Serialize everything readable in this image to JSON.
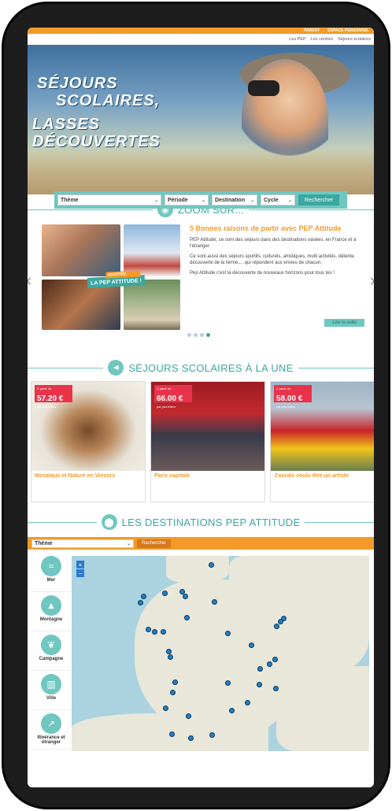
{
  "topbar": {
    "links": [
      "PARENT",
      "ESPACE PERSONNEL"
    ]
  },
  "subnav": {
    "links": [
      "Les PEP",
      "Les centres",
      "Séjours scolaires"
    ]
  },
  "hero": {
    "title_line1": "SÉJOURS",
    "title_line2": "SCOLAIRES,",
    "title_line3": "LASSES",
    "title_line4": "DÉCOUVERTES"
  },
  "search": {
    "theme": "Thème",
    "periode": "Période",
    "destination": "Destination",
    "cycle": "Cycle",
    "button": "Rechercher"
  },
  "zoom": {
    "section_title": "ZOOM SUR...",
    "badge_top": "ADOPTEZ",
    "badge": "LA PEP ATTITUDE !",
    "heading": "5 Bonnes raisons de partir avec PEP Attitude",
    "p1": "PEP Attitude, ce sont des séjours dans des destinations variées, en France et à l'étranger.",
    "p2": "Ce sont aussi des séjours sportifs, culturels, artistiques, multi activités, détente, découverte de la ferme,... qui répondent aux envies de chacun.",
    "p3": "Pep Attitude c'est la découverte de nouveaux horizons pour tous tes !",
    "button": "Lire la suite"
  },
  "une": {
    "section_title": "SÉJOURS SCOLAIRES À LA UNE",
    "price_prefix": "À partir de",
    "price_suffix": "par jour/élève",
    "cards": [
      {
        "price": "57.20 €",
        "title": "Mosaïque et Nature en Vercors"
      },
      {
        "price": "66.00 €",
        "title": "Paris capitale"
      },
      {
        "price": "58.00 €",
        "title": "J'aurais voulu être un artiste"
      }
    ]
  },
  "destinations": {
    "section_title": "LES DESTINATIONS PEP ATTITUDE",
    "theme": "Thème",
    "button": "Rechercher",
    "categories": [
      "Mer",
      "Montagne",
      "Campagne",
      "Ville",
      "Itinérance et étranger"
    ]
  },
  "map": {
    "zoom_in": "+",
    "zoom_out": "−"
  }
}
